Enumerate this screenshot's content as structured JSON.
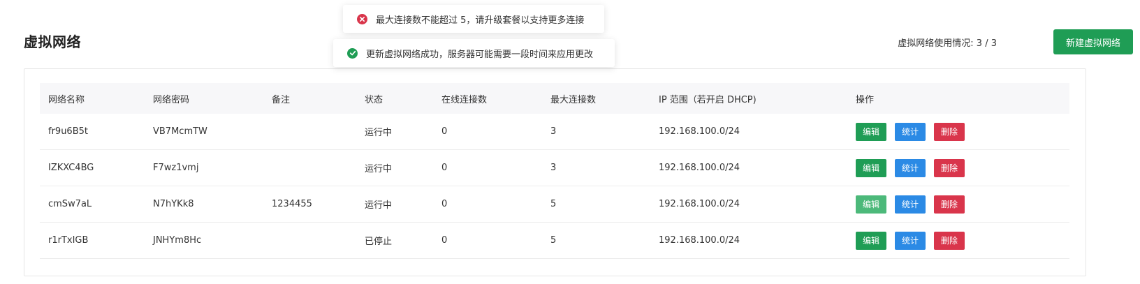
{
  "page": {
    "title": "虚拟网络",
    "usage": "虚拟网络使用情况: 3 / 3",
    "create_label": "新建虚拟网络"
  },
  "toasts": [
    {
      "type": "error",
      "icon": "error-circle-icon",
      "text": "最大连接数不能超过 5，请升级套餐以支持更多连接"
    },
    {
      "type": "success",
      "icon": "check-circle-icon",
      "text": "更新虚拟网络成功，服务器可能需要一段时间来应用更改"
    }
  ],
  "table": {
    "headers": [
      "网络名称",
      "网络密码",
      "备注",
      "状态",
      "在线连接数",
      "最大连接数",
      "IP 范围（若开启 DHCP)",
      "操作"
    ],
    "rows": [
      {
        "name": "fr9u6B5t",
        "password": "VB7McmTW",
        "note": "",
        "status": "运行中",
        "online": "0",
        "max": "3",
        "ip": "192.168.100.0/24"
      },
      {
        "name": "IZKXC4BG",
        "password": "F7wz1vmj",
        "note": "",
        "status": "运行中",
        "online": "0",
        "max": "3",
        "ip": "192.168.100.0/24"
      },
      {
        "name": "cmSw7aL",
        "password": "N7hYKk8",
        "note": "1234455",
        "status": "运行中",
        "online": "0",
        "max": "5",
        "ip": "192.168.100.0/24"
      },
      {
        "name": "r1rTxIGB",
        "password": "JNHYm8Hc",
        "note": "",
        "status": "已停止",
        "online": "0",
        "max": "5",
        "ip": "192.168.100.0/24"
      }
    ],
    "actions": {
      "edit": "编辑",
      "stats": "统计",
      "delete": "删除"
    }
  },
  "colors": {
    "primary_green": "#1f9d55",
    "blue": "#2b8ae5",
    "red": "#d9354b"
  }
}
